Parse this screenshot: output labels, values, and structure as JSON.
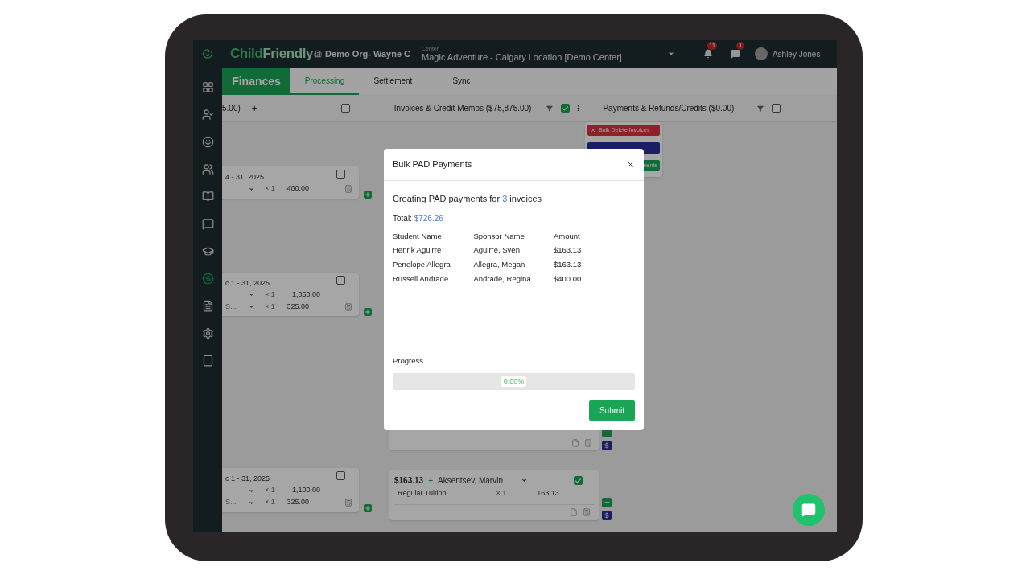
{
  "top_bar": {
    "brand_first": "Child",
    "brand_second": "Friendly",
    "organization": "Demo Org- Wayne C",
    "center_label": "Center",
    "center": "Magic Adventure - Calgary Location [Demo Center]",
    "notifications_count": "11",
    "messages_count": "1",
    "user": "Ashley Jones"
  },
  "sidebar": {
    "items": [
      {
        "kind": "grid",
        "selected": false
      },
      {
        "kind": "check-in",
        "selected": false
      },
      {
        "kind": "child",
        "selected": false
      },
      {
        "kind": "people",
        "selected": false
      },
      {
        "kind": "book",
        "selected": false
      },
      {
        "kind": "chat",
        "selected": false
      },
      {
        "kind": "school",
        "selected": false
      },
      {
        "kind": "finance",
        "selected": true
      },
      {
        "kind": "document",
        "selected": false
      },
      {
        "kind": "settings",
        "selected": false
      },
      {
        "kind": "tablet",
        "selected": false
      }
    ]
  },
  "module": {
    "title": "Finances",
    "tabs": [
      {
        "label": "Processing",
        "selected": true
      },
      {
        "label": "Settlement",
        "selected": false
      },
      {
        "label": "Sync",
        "selected": false
      }
    ]
  },
  "columns_bar": {
    "left_total": "5.00)",
    "add": "+",
    "left_checked": false,
    "invoices_title": "Invoices & Credit Memos ($75,875.00)",
    "invoices_checked": true,
    "payments_title": "Payments & Refunds/Credits ($0.00)",
    "payments_checked": false
  },
  "actions_menu": {
    "items": [
      {
        "kind": "danger",
        "label": "Bulk Delete Invoices"
      },
      {
        "kind": "primary"
      },
      {
        "kind": "success",
        "label": "nents"
      }
    ]
  },
  "left_cards": [
    {
      "period": "4 - 31, 2025",
      "checked": false,
      "lines": [
        {
          "quantity": "× 1",
          "amount": "400.00"
        }
      ]
    },
    {
      "period": "c 1 - 31, 2025",
      "checked": false,
      "lines": [
        {
          "quantity": "× 1",
          "amount": "1,050.00"
        },
        {
          "name": "S...",
          "quantity": "× 1",
          "amount": "325.00"
        }
      ]
    },
    {
      "period": "c 1 - 31, 2025",
      "checked": false,
      "lines": [
        {
          "quantity": "× 1",
          "amount": "1,100.00"
        },
        {
          "name": "S...",
          "quantity": "× 1",
          "amount": "325.00"
        }
      ]
    }
  ],
  "invoice_card": {
    "amount": "$163.13",
    "add": "+",
    "sponsor": "Aksentsev, Marvin",
    "checked": true,
    "lines": [
      {
        "name": "Regular Tuition",
        "quantity": "× 1",
        "amount": "163.13"
      }
    ]
  },
  "modal": {
    "title": "Bulk PAD Payments",
    "intro_prefix": "Creating PAD payments for",
    "count": "3",
    "intro_suffix": "invoices",
    "total_label": "Total:",
    "total": "$726.26",
    "table": {
      "columns": [
        "Student Name",
        "Sponsor Name",
        "Amount"
      ],
      "rows": [
        [
          "Henrik Aguirre",
          "Aguirre, Sven",
          "$163.13"
        ],
        [
          "Penelope Allegra",
          "Allegra, Megan",
          "$163.13"
        ],
        [
          "Russell Andrade",
          "Andrade, Regina",
          "$400.00"
        ]
      ]
    },
    "progress_label": "Progress",
    "progress": {
      "level": 0,
      "reading": "0.00%"
    },
    "submit": "Submit"
  }
}
